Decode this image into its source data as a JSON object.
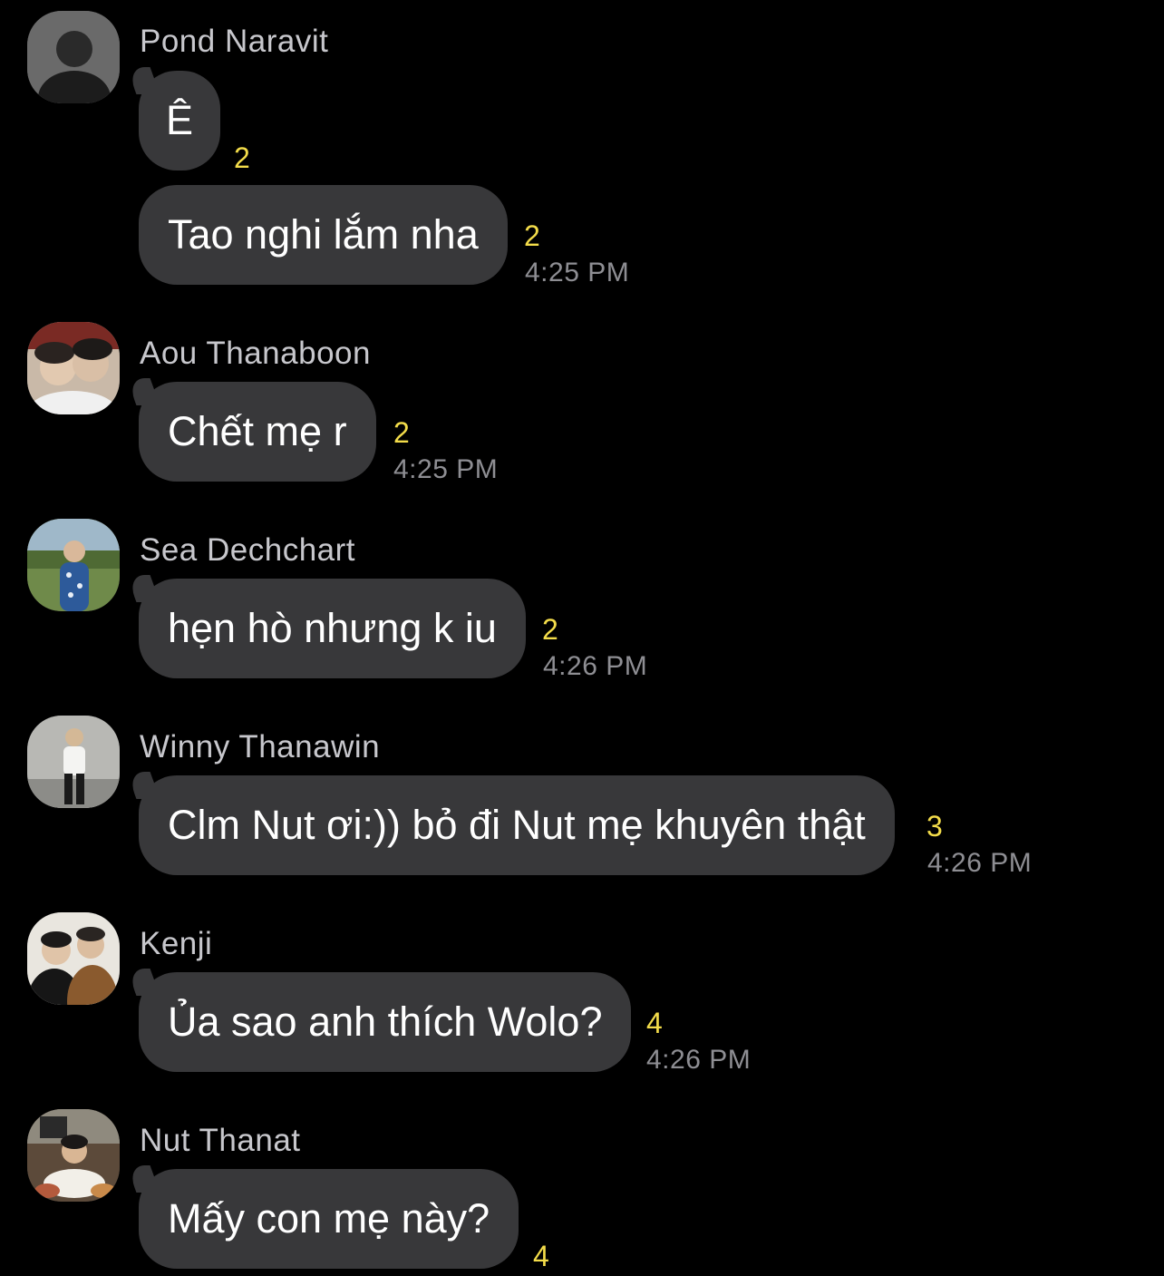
{
  "colors": {
    "background": "#000000",
    "bubble": "#38383a",
    "text": "#ffffff",
    "sender": "#c7c7cc",
    "unread_count": "#f3dc4a",
    "timestamp": "#8e8e93"
  },
  "messages": [
    {
      "sender": "Pond Naravit",
      "avatar": "profile-photo",
      "bubbles": [
        {
          "text": "Ê",
          "count": "2",
          "time": ""
        },
        {
          "text": "Tao nghi lắm nha",
          "count": "2",
          "time": "4:25 PM"
        }
      ]
    },
    {
      "sender": "Aou Thanaboon",
      "avatar": "profile-photo",
      "bubbles": [
        {
          "text": "Chết mẹ r",
          "count": "2",
          "time": "4:25 PM"
        }
      ]
    },
    {
      "sender": "Sea Dechchart",
      "avatar": "profile-photo",
      "bubbles": [
        {
          "text": "hẹn hò nhưng k iu",
          "count": "2",
          "time": "4:26 PM"
        }
      ]
    },
    {
      "sender": "Winny Thanawin",
      "avatar": "profile-photo",
      "bubbles": [
        {
          "text": "Clm Nut ơi:)) bỏ đi Nut mẹ khuyên thật",
          "count": "3",
          "time": "4:26 PM"
        }
      ]
    },
    {
      "sender": "Kenji",
      "avatar": "profile-photo",
      "bubbles": [
        {
          "text": "Ủa sao anh thích Wolo?",
          "count": "4",
          "time": "4:26 PM"
        }
      ]
    },
    {
      "sender": "Nut Thanat",
      "avatar": "profile-photo",
      "bubbles": [
        {
          "text": "Mấy con mẹ này?",
          "count": "4",
          "time": ""
        }
      ]
    }
  ]
}
